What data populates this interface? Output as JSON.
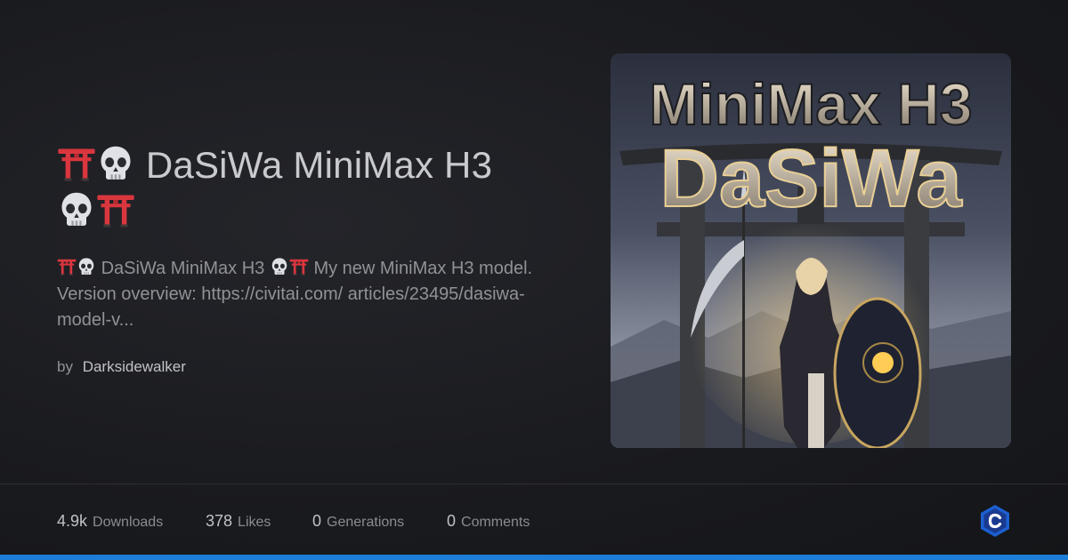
{
  "title": {
    "prefix_emoji": "torii-skull",
    "text": "DaSiWa MiniMax H3",
    "suffix_emoji": "skull-torii"
  },
  "description": {
    "lead": "DaSiWa MiniMax H3",
    "body": "My new MiniMax H3 model. Version overview: https://civitai.com/ articles/23495/dasiwa-model-v..."
  },
  "byline": {
    "by": "by",
    "author": "Darksidewalker"
  },
  "cover": {
    "line1": "MiniMax H3",
    "line2": "DaSiWa"
  },
  "stats": [
    {
      "value": "4.9k",
      "label": "Downloads"
    },
    {
      "value": "378",
      "label": "Likes"
    },
    {
      "value": "0",
      "label": "Generations"
    },
    {
      "value": "0",
      "label": "Comments"
    }
  ],
  "colors": {
    "accent": "#1c7ed6",
    "torii": "#d9363e",
    "logo": "#1c5fd0"
  },
  "icons": {
    "torii": "torii-gate-icon",
    "skull": "skull-icon",
    "logo": "civitai-logo-icon"
  }
}
